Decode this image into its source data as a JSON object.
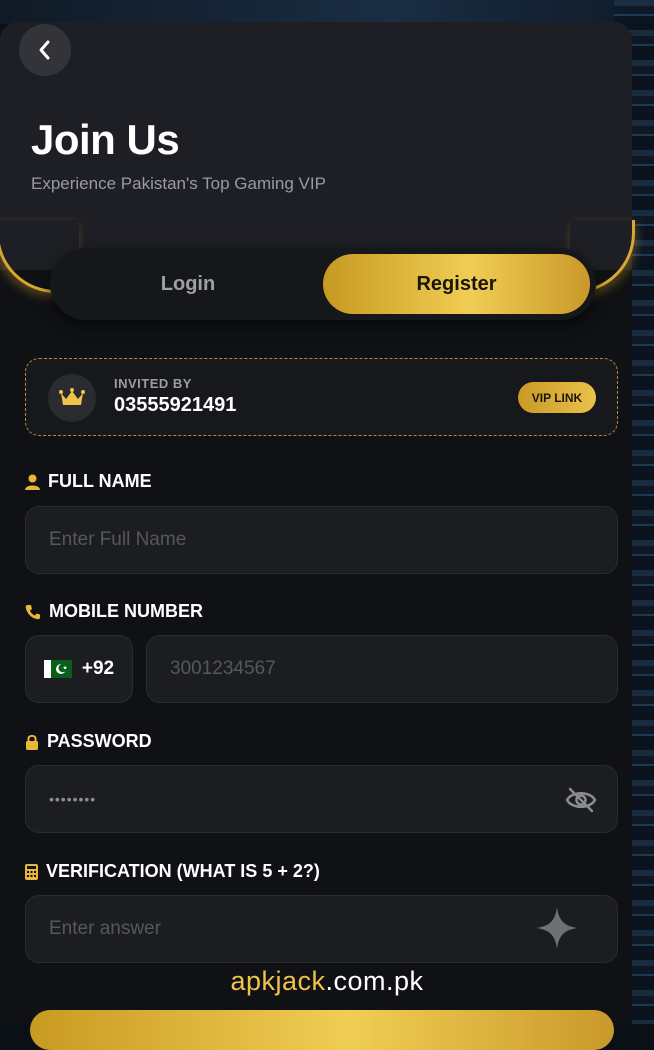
{
  "header": {
    "title": "Join Us",
    "subtitle": "Experience Pakistan's Top Gaming VIP"
  },
  "tabs": {
    "login": "Login",
    "register": "Register",
    "active": "register"
  },
  "invite": {
    "label": "INVITED BY",
    "value": "03555921491",
    "badge": "VIP LINK"
  },
  "fields": {
    "full_name": {
      "label": "FULL NAME",
      "placeholder": "Enter Full Name"
    },
    "mobile": {
      "label": "MOBILE NUMBER",
      "country_code": "+92",
      "placeholder": "3001234567"
    },
    "password": {
      "label": "PASSWORD",
      "value": "••••••••"
    },
    "verification": {
      "label": "VERIFICATION (WHAT IS 5 + 2?)",
      "placeholder": "Enter answer"
    }
  },
  "watermark": {
    "part1": "apkjack",
    "part2": ".com.pk"
  },
  "icons": {
    "back": "chevron-left-icon",
    "crown": "crown-icon",
    "user": "user-icon",
    "phone": "phone-icon",
    "lock": "lock-icon",
    "calculator": "calculator-icon",
    "eye_off": "eye-off-icon",
    "sparkle": "sparkle-icon"
  },
  "colors": {
    "gold": "#e9c24a",
    "background": "#0f1114",
    "card": "#1c1d21"
  }
}
